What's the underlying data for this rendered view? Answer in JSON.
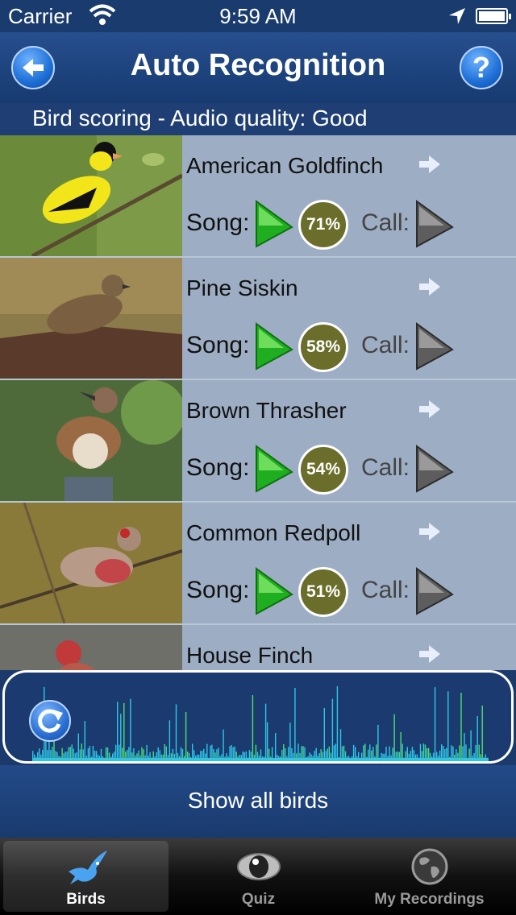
{
  "status_bar": {
    "carrier": "Carrier",
    "time": "9:59 AM"
  },
  "nav": {
    "title": "Auto Recognition",
    "help_label": "?"
  },
  "subheader": {
    "text": "Bird scoring - Audio quality: Good"
  },
  "birds": [
    {
      "name": "American Goldfinch",
      "song_label": "Song:",
      "score": "71%",
      "call_label": "Call:"
    },
    {
      "name": "Pine Siskin",
      "song_label": "Song:",
      "score": "58%",
      "call_label": "Call:"
    },
    {
      "name": "Brown Thrasher",
      "song_label": "Song:",
      "score": "54%",
      "call_label": "Call:"
    },
    {
      "name": "Common Redpoll",
      "song_label": "Song:",
      "score": "51%",
      "call_label": "Call:"
    },
    {
      "name": "House Finch"
    }
  ],
  "show_all": {
    "label": "Show all birds"
  },
  "tabs": [
    {
      "label": "Birds",
      "icon": "bird-icon",
      "active": true
    },
    {
      "label": "Quiz",
      "icon": "eye-icon",
      "active": false
    },
    {
      "label": "My Recordings",
      "icon": "globe-icon",
      "active": false
    }
  ],
  "colors": {
    "accent": "#1e6fd6",
    "score_badge": "#6b6e2a",
    "list_bg": "#9daec4",
    "song_play": "#22b322",
    "call_play": "#6a6a6a"
  }
}
